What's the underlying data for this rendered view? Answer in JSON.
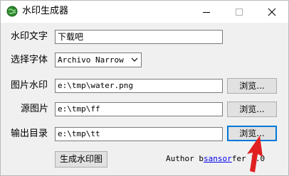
{
  "window": {
    "title": "水印生成器",
    "icon": "globe-icon",
    "controls": {
      "minimize": "minimize-icon",
      "maximize": "maximize-icon",
      "close": "close-icon"
    }
  },
  "form": {
    "watermark_text": {
      "label": "水印文字",
      "value": "下载吧"
    },
    "font": {
      "label": "选择字体",
      "value": "Archivo Narrow"
    },
    "image_watermark": {
      "label": "图片水印",
      "value": "e:\\tmp\\water.png",
      "browse_label": "浏览..."
    },
    "source_image": {
      "label": "源图片",
      "value": "e:\\tmp\\ff",
      "browse_label": "浏览..."
    },
    "output_dir": {
      "label": "输出目录",
      "value": "e:\\tmp\\tt",
      "browse_label": "浏览..."
    }
  },
  "actions": {
    "generate_label": "生成水印图"
  },
  "credit": {
    "prefix": "Author b",
    "link": "sansor",
    "suffix": "fer 1.0"
  },
  "colors": {
    "annotation_arrow": "#e02020",
    "link": "#0000ee",
    "focus": "#0078d7"
  }
}
